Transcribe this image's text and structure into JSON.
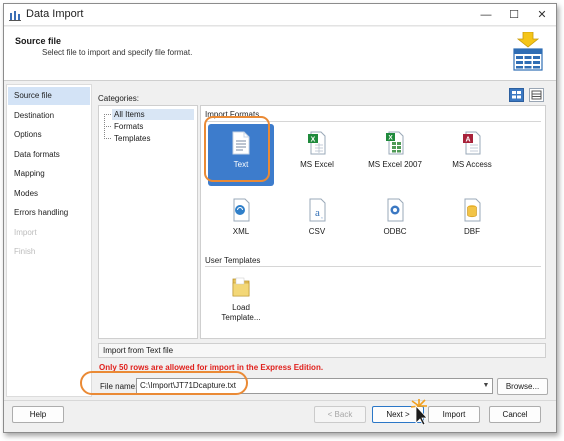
{
  "window": {
    "title": "Data Import",
    "buttons": {
      "minimize": "—",
      "maximize": "☐",
      "close": "✕"
    }
  },
  "header": {
    "title": "Source file",
    "description": "Select file to import and specify file format."
  },
  "sidebar": {
    "items": [
      {
        "label": "Source file",
        "state": "active"
      },
      {
        "label": "Destination",
        "state": "normal"
      },
      {
        "label": "Options",
        "state": "normal"
      },
      {
        "label": "Data formats",
        "state": "normal"
      },
      {
        "label": "Mapping",
        "state": "normal"
      },
      {
        "label": "Modes",
        "state": "normal"
      },
      {
        "label": "Errors handling",
        "state": "normal"
      },
      {
        "label": "Import",
        "state": "disabled"
      },
      {
        "label": "Finish",
        "state": "disabled"
      }
    ]
  },
  "categories": {
    "label": "Categories:",
    "items": [
      "All Items",
      "Formats",
      "Templates"
    ]
  },
  "formats": {
    "section_title": "Import Formats",
    "items": [
      {
        "label": "Text",
        "icon": "text-file-icon"
      },
      {
        "label": "MS Excel",
        "icon": "excel-file-icon"
      },
      {
        "label": "MS Excel 2007",
        "icon": "excel-2007-file-icon"
      },
      {
        "label": "MS Access",
        "icon": "access-file-icon"
      },
      {
        "label": "XML",
        "icon": "xml-file-icon"
      },
      {
        "label": "CSV",
        "icon": "csv-file-icon"
      },
      {
        "label": "ODBC",
        "icon": "odbc-file-icon"
      },
      {
        "label": "DBF",
        "icon": "dbf-file-icon"
      }
    ],
    "selected": "Text"
  },
  "templates": {
    "section_title": "User Templates",
    "load_label_line1": "Load",
    "load_label_line2": "Template..."
  },
  "status": "Import from Text file",
  "warning": "Only 50 rows are allowed for import in the Express Edition.",
  "file": {
    "label": "File name:",
    "value": "C:\\Import\\JT71Dcapture.txt",
    "browse_label": "Browse..."
  },
  "footer": {
    "help": "Help",
    "back": "< Back",
    "next": "Next >",
    "import": "Import",
    "cancel": "Cancel"
  },
  "colors": {
    "accent": "#3d7ccc",
    "highlight": "#ea8a35",
    "warning": "#e0201c",
    "sidebar_active": "#d3e3f6"
  }
}
